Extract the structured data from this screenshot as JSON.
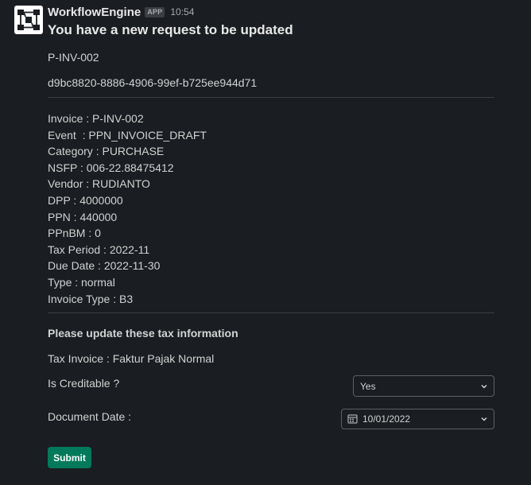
{
  "message": {
    "app_name": "WorkflowEngine",
    "app_badge": "APP",
    "time": "10:54",
    "avatar_icon": "workflow-diagram-icon",
    "title": "You have a new request to be updated",
    "reference": "P-INV-002",
    "request_id": "d9bc8820-8886-4906-99ef-b725ee944d71"
  },
  "details": [
    "Invoice : P-INV-002",
    "Event  : PPN_INVOICE_DRAFT",
    "Category : PURCHASE",
    "NSFP : 006-22.88475412",
    "Vendor : RUDIANTO",
    "DPP : 4000000",
    "PPN : 440000",
    "PPnBM : 0",
    "Tax Period : 2022-11",
    "Due Date : 2022-11-30",
    "Type : normal",
    "Invoice Type : B3"
  ],
  "form": {
    "heading": "Please update these tax information",
    "tax_invoice": "Tax Invoice : Faktur Pajak Normal",
    "is_creditable_label": "Is Creditable ?",
    "is_creditable_value": "Yes",
    "document_date_label": "Document Date :",
    "document_date_value": "10/01/2022",
    "submit_label": "Submit"
  },
  "colors": {
    "background": "#1a1d21",
    "text": "#d1d2d3",
    "submit_button": "#007a5a",
    "border": "#5d5f63"
  }
}
